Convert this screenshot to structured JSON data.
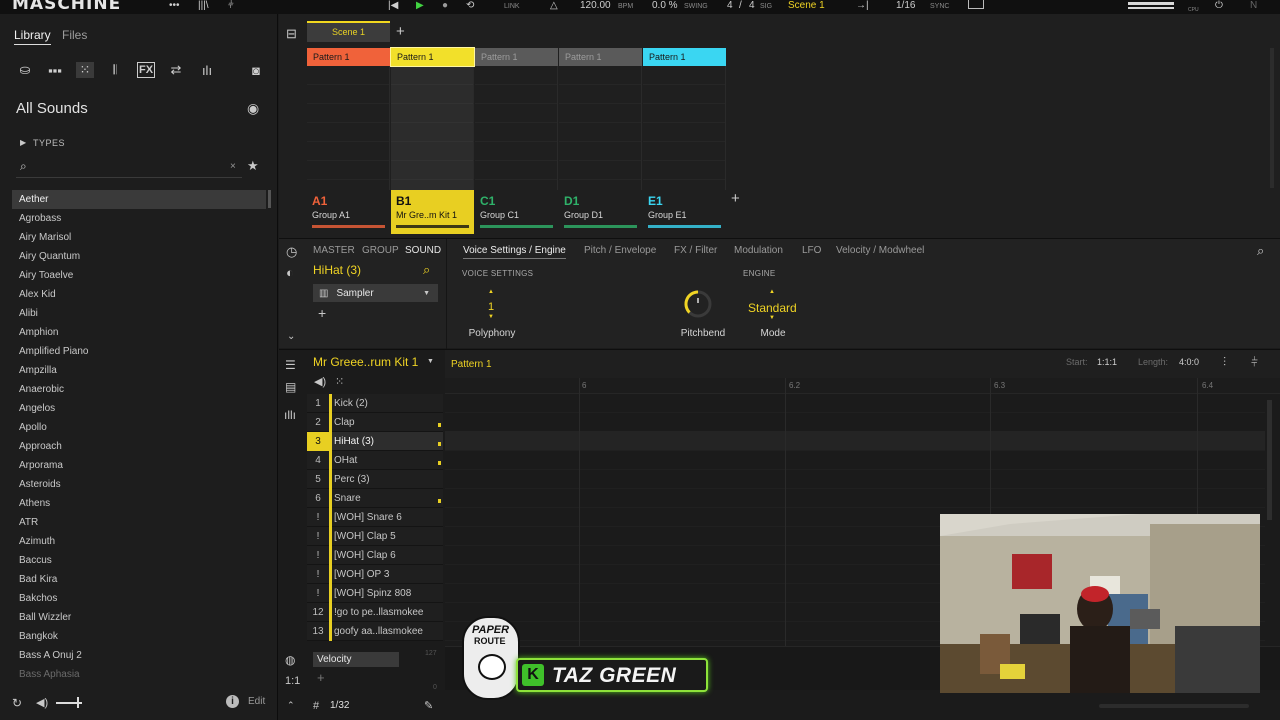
{
  "topbar": {
    "logo": "MASCHINE",
    "link": "LINK",
    "tempo": "120.00",
    "tempo_unit": "BPM",
    "swing": "0.0 %",
    "swing_label": "SWING",
    "sig_num": "4",
    "sig_slash": "/",
    "sig_den": "4",
    "sig_label": "SIG",
    "scene": "Scene 1",
    "quantize": "1/16",
    "sync": "SYNC",
    "cpu": "CPU"
  },
  "library": {
    "tabs": [
      "Library",
      "Files"
    ],
    "title": "All Sounds",
    "types_label": "TYPES",
    "sounds": [
      "Aether",
      "Agrobass",
      "Airy Marisol",
      "Airy Quantum",
      "Airy Toaelve",
      "Alex Kid",
      "Alibi",
      "Amphion",
      "Amplified Piano",
      "Ampzilla",
      "Anaerobic",
      "Angelos",
      "Apollo",
      "Approach",
      "Arporama",
      "Asteroids",
      "Athens",
      "ATR",
      "Azimuth",
      "Baccus",
      "Bad Kira",
      "Bakchos",
      "Ball Wizzler",
      "Bangkok",
      "Bass A Onuj 2",
      "Bass Aphasia"
    ],
    "edit_label": "Edit"
  },
  "arranger": {
    "scene_tab": "Scene 1",
    "patterns": [
      {
        "label": "Pattern 1",
        "color": "#f0623a"
      },
      {
        "label": "Pattern 1",
        "color": "#f2e02a"
      },
      {
        "label": "Pattern 1",
        "color": "#8a8a8a"
      },
      {
        "label": "Pattern 1",
        "color": "#8a8a8a"
      },
      {
        "label": "Pattern 1",
        "color": "#3ad6f2"
      }
    ],
    "groups": [
      {
        "id": "A1",
        "name": "Group A1",
        "color": "#f0623a"
      },
      {
        "id": "B1",
        "name": "Mr Gre..m Kit 1",
        "color": "#f2e02a"
      },
      {
        "id": "C1",
        "name": "Group C1",
        "color": "#2fb26a"
      },
      {
        "id": "D1",
        "name": "Group D1",
        "color": "#2fb26a"
      },
      {
        "id": "E1",
        "name": "Group E1",
        "color": "#3ad6f2"
      }
    ]
  },
  "controls": {
    "level_tabs": [
      "MASTER",
      "GROUP",
      "SOUND"
    ],
    "sound_name": "HiHat (3)",
    "plugin": "Sampler",
    "page_tabs": [
      "Voice Settings / Engine",
      "Pitch / Envelope",
      "FX / Filter",
      "Modulation",
      "LFO",
      "Velocity / Modwheel"
    ],
    "voice_settings_label": "VOICE SETTINGS",
    "engine_label": "ENGINE",
    "polyphony_value": "1",
    "polyphony_label": "Polyphony",
    "pitchbend_label": "Pitchbend",
    "mode_value": "Standard",
    "mode_label": "Mode"
  },
  "editor": {
    "kit_name": "Mr Greee..rum Kit 1",
    "pattern_name": "Pattern 1",
    "start_label": "Start:",
    "start_value": "1:1:1",
    "length_label": "Length:",
    "length_value": "4:0:0",
    "ruler": [
      "6",
      "6.2",
      "6.3",
      "6.4"
    ],
    "pads": [
      {
        "num": "1",
        "name": "Kick (2)",
        "active": false
      },
      {
        "num": "2",
        "name": "Clap",
        "active": true
      },
      {
        "num": "3",
        "name": "HiHat (3)",
        "active": true
      },
      {
        "num": "4",
        "name": "OHat",
        "active": true
      },
      {
        "num": "5",
        "name": "Perc (3)",
        "active": false
      },
      {
        "num": "6",
        "name": "Snare",
        "active": true
      },
      {
        "num": "!",
        "name": "[WOH] Snare 6",
        "active": false
      },
      {
        "num": "!",
        "name": "[WOH] Clap 5",
        "active": false
      },
      {
        "num": "!",
        "name": "[WOH] Clap 6",
        "active": false
      },
      {
        "num": "!",
        "name": "[WOH] OP 3",
        "active": false
      },
      {
        "num": "!",
        "name": "[WOH] Spinz 808",
        "active": false
      },
      {
        "num": "12",
        "name": "!go to pe..llasmokee",
        "active": false
      },
      {
        "num": "13",
        "name": "goofy aa..llasmokee",
        "active": false
      }
    ],
    "velocity_label": "Velocity",
    "velocity_max": "127",
    "velocity_min": "0",
    "grid_value": "1/32"
  },
  "overlay": {
    "brand_top": "PAPER",
    "brand_bottom": "ROUTE",
    "name": "TAZ GREEN"
  }
}
